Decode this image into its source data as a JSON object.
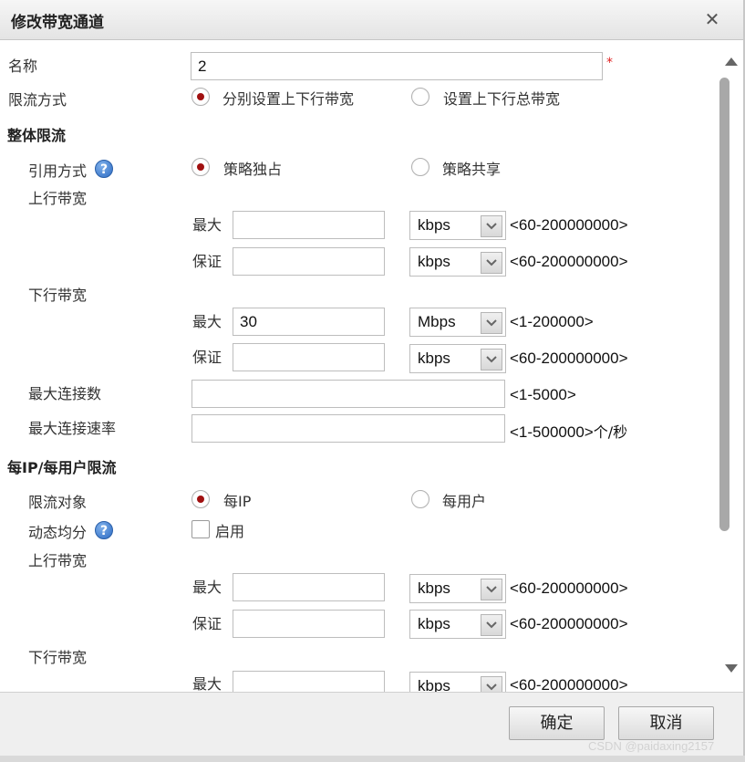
{
  "dialog": {
    "title": "修改带宽通道",
    "close": "✕"
  },
  "form": {
    "name_label": "名称",
    "name_value": "2",
    "required_mark": "*",
    "limit_mode_label": "限流方式",
    "limit_mode_option1": "分别设置上下行带宽",
    "limit_mode_option2": "设置上下行总带宽",
    "limit_mode_selected": 1
  },
  "overall": {
    "section_title": "整体限流",
    "ref_mode_label": "引用方式",
    "ref_option1": "策略独占",
    "ref_option2": "策略共享",
    "up_bw_label": "上行带宽",
    "down_bw_label": "下行带宽",
    "max_label": "最大",
    "guarantee_label": "保证",
    "up_max_value": "",
    "up_max_unit": "kbps",
    "up_max_range": "<60-200000000>",
    "up_guar_value": "",
    "up_guar_unit": "kbps",
    "up_guar_range": "<60-200000000>",
    "down_max_value": "30",
    "down_max_unit": "Mbps",
    "down_max_range": "<1-200000>",
    "down_guar_value": "",
    "down_guar_unit": "kbps",
    "down_guar_range": "<60-200000000>",
    "max_conn_label": "最大连接数",
    "max_conn_value": "",
    "max_conn_range": "<1-5000>",
    "max_rate_label": "最大连接速率",
    "max_rate_value": "",
    "max_rate_range": "<1-500000>",
    "max_rate_suffix": "个/秒"
  },
  "per_ip": {
    "section_title": "每IP/每用户限流",
    "target_label": "限流对象",
    "target_option1": "每IP",
    "target_option2": "每用户",
    "dynamic_label": "动态均分",
    "enable_label": "启用",
    "up_bw_label": "上行带宽",
    "down_bw_label": "下行带宽",
    "max_label": "最大",
    "guarantee_label": "保证",
    "up_max_unit": "kbps",
    "up_max_range": "<60-200000000>",
    "up_guar_unit": "kbps",
    "up_guar_range": "<60-200000000>",
    "down_max_unit": "kbps",
    "down_max_range": "<60-200000000>"
  },
  "help_icon": "?",
  "footer": {
    "ok": "确定",
    "cancel": "取消"
  },
  "watermark": "CSDN @paidaxing2157",
  "colors": {
    "radio_selected": "#a01010",
    "required": "#e02020",
    "help_icon": "#2d6cc4"
  }
}
